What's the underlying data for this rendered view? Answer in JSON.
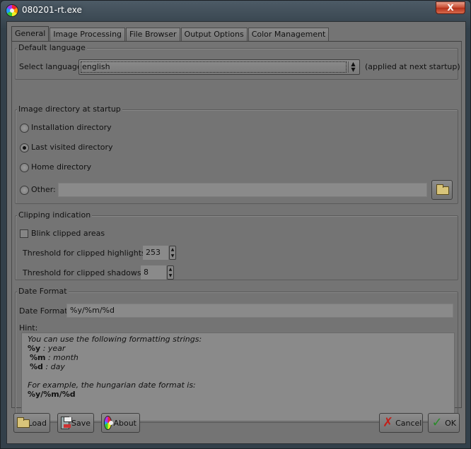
{
  "window": {
    "title": "080201-rt.exe",
    "close_label": "X"
  },
  "tabs": [
    {
      "label": "General"
    },
    {
      "label": "Image Processing"
    },
    {
      "label": "File Browser"
    },
    {
      "label": "Output Options"
    },
    {
      "label": "Color Management"
    }
  ],
  "language": {
    "group_title": "Default language",
    "select_label": "Select language:",
    "selected": "english",
    "note": "(applied at next startup)"
  },
  "image_dir": {
    "group_title": "Image directory at startup",
    "options": [
      {
        "label": "Installation directory",
        "checked": false
      },
      {
        "label": "Last visited directory",
        "checked": true
      },
      {
        "label": "Home directory",
        "checked": false
      },
      {
        "label": "Other:",
        "checked": false
      }
    ],
    "other_path": ""
  },
  "clipping": {
    "group_title": "Clipping indication",
    "blink_label": "Blink clipped areas",
    "blink_checked": false,
    "highlights_label": "Threshold for clipped highlights:",
    "highlights_value": "253",
    "shadows_label": "Threshold for clipped shadows:",
    "shadows_value": "8"
  },
  "date_format": {
    "group_title": "Date Format",
    "field_label": "Date Format:",
    "value": "%y/%m/%d",
    "hint_label": "Hint:",
    "hint_intro": "You can use the following formatting strings:",
    "codes": [
      {
        "code": "%y",
        "desc": " : year"
      },
      {
        "code": "%m",
        "desc": " : month"
      },
      {
        "code": "%d",
        "desc": " : day"
      }
    ],
    "example_intro": "For example, the hungarian date format is:",
    "example_value": "%y/%m/%d"
  },
  "buttons": {
    "load": "Load",
    "save": "Save",
    "about": "About",
    "cancel": "Cancel",
    "ok": "OK"
  }
}
